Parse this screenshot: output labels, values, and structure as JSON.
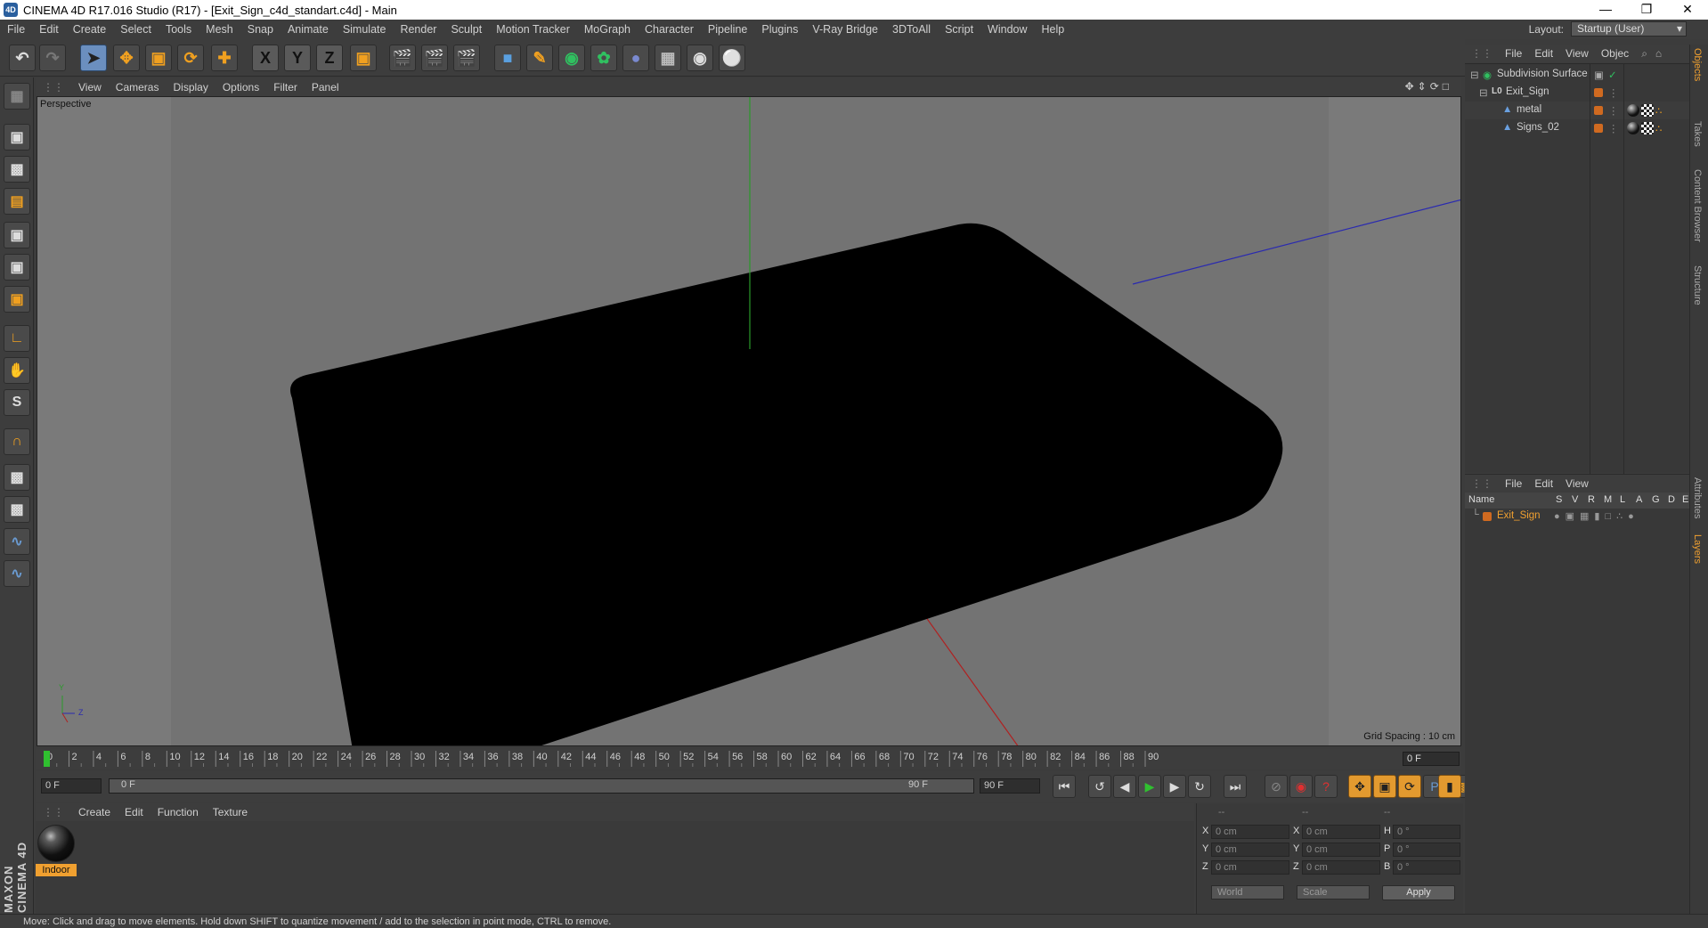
{
  "window": {
    "title": "CINEMA 4D R17.016 Studio (R17) - [Exit_Sign_c4d_standart.c4d] - Main",
    "app_icon": "cinema4d-icon",
    "controls": [
      "minimize",
      "restore",
      "close"
    ]
  },
  "menubar": {
    "items": [
      "File",
      "Edit",
      "Create",
      "Select",
      "Tools",
      "Mesh",
      "Snap",
      "Animate",
      "Simulate",
      "Render",
      "Sculpt",
      "Motion Tracker",
      "MoGraph",
      "Character",
      "Pipeline",
      "Plugins",
      "V-Ray Bridge",
      "3DToAll",
      "Script",
      "Window",
      "Help"
    ],
    "layout_label": "Layout:",
    "layout_value": "Startup (User)"
  },
  "toolbar": {
    "axis_x": "X",
    "axis_y": "Y",
    "axis_z": "Z"
  },
  "viewport": {
    "menu": [
      "View",
      "Cameras",
      "Display",
      "Options",
      "Filter",
      "Panel"
    ],
    "camera_label": "Perspective",
    "grid_spacing": "Grid Spacing : 10 cm",
    "axis_y": "Y",
    "axis_z": "Z",
    "colors": {
      "background": "#7a7a7a",
      "floor": "#6a6a6a",
      "object": "#000000",
      "x_axis": "#b02020",
      "y_axis": "#2a9a2a",
      "z_axis": "#2a2ab0"
    }
  },
  "timeline": {
    "ticks": [
      "0",
      "2",
      "4",
      "6",
      "8",
      "10",
      "12",
      "14",
      "16",
      "18",
      "20",
      "22",
      "24",
      "26",
      "28",
      "30",
      "32",
      "34",
      "36",
      "38",
      "40",
      "42",
      "44",
      "46",
      "48",
      "50",
      "52",
      "54",
      "56",
      "58",
      "60",
      "62",
      "64",
      "66",
      "68",
      "70",
      "72",
      "74",
      "76",
      "78",
      "80",
      "82",
      "84",
      "86",
      "88",
      "90"
    ],
    "current_frame": 0,
    "current_frame_label": "0 F"
  },
  "transport": {
    "start_frame": "0 F",
    "range_start": "0 F",
    "range_end": "90 F",
    "end_frame": "90 F"
  },
  "material_manager": {
    "menu": [
      "Create",
      "Edit",
      "Function",
      "Texture"
    ],
    "materials": [
      {
        "name": "Indoor"
      }
    ]
  },
  "coordinates": {
    "header": [
      "--",
      "--",
      "--"
    ],
    "rows": [
      {
        "a": "X",
        "v1": "0 cm",
        "b": "X",
        "v2": "0 cm",
        "c": "H",
        "v3": "0 °"
      },
      {
        "a": "Y",
        "v1": "0 cm",
        "b": "Y",
        "v2": "0 cm",
        "c": "P",
        "v3": "0 °"
      },
      {
        "a": "Z",
        "v1": "0 cm",
        "b": "Z",
        "v2": "0 cm",
        "c": "B",
        "v3": "0 °"
      }
    ],
    "space": "World",
    "mode": "Scale",
    "apply": "Apply"
  },
  "object_manager": {
    "menu": [
      "File",
      "Edit",
      "View",
      "Objec"
    ],
    "objects": [
      {
        "name": "Subdivision Surface",
        "icon": "subdivision-icon",
        "indent": 0,
        "color": "#2ab04a"
      },
      {
        "name": "Exit_Sign",
        "icon": "null-object-icon",
        "indent": 1,
        "color": "#d0d0d0"
      },
      {
        "name": "metal",
        "icon": "polygon-object-icon",
        "indent": 2,
        "color": "#d0d0d0"
      },
      {
        "name": "Signs_02",
        "icon": "polygon-object-icon",
        "indent": 2,
        "color": "#d0d0d0"
      }
    ]
  },
  "layer_manager": {
    "menu": [
      "File",
      "Edit",
      "View"
    ],
    "columns": [
      "Name",
      "S",
      "V",
      "R",
      "M",
      "L",
      "A",
      "G",
      "D",
      "E"
    ],
    "layers": [
      {
        "name": "Exit_Sign",
        "color": "#d06a20"
      }
    ]
  },
  "side_tabs": [
    "Objects",
    "Takes",
    "Content Browser",
    "Structure",
    "Attributes",
    "Layers"
  ],
  "status": {
    "text": "Move: Click and drag to move elements. Hold down SHIFT to quantize movement / add to the selection in point mode, CTRL to remove."
  }
}
